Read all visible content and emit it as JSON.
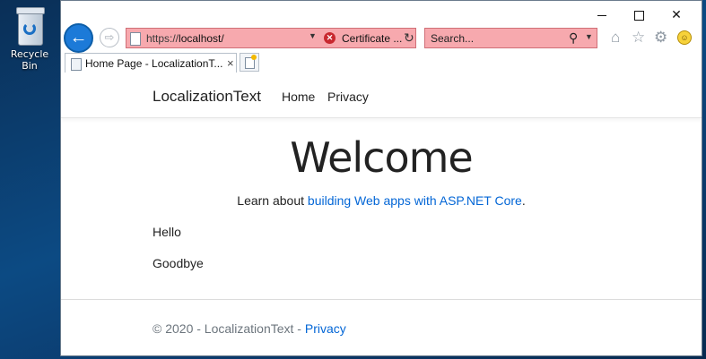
{
  "desktop": {
    "recycle_bin_label": "Recycle Bin"
  },
  "browser": {
    "address": {
      "scheme": "https://",
      "host": "localhost/",
      "certificate_label": "Certificate ..."
    },
    "search": {
      "placeholder": "Search..."
    },
    "tab": {
      "title": "Home Page - LocalizationT...",
      "close_glyph": "×"
    },
    "window_controls": {
      "close_glyph": "✕"
    },
    "icons": {
      "back": "back-arrow-icon",
      "forward": "forward-arrow-icon",
      "home": "home-icon",
      "favorites": "star-icon",
      "tools": "gear-icon",
      "feedback": "smiley-icon"
    },
    "colors": {
      "certificate_error_bg": "#f7a9ae",
      "back_button": "#1c7ad8"
    }
  },
  "site": {
    "brand": "LocalizationText",
    "nav": [
      {
        "label": "Home"
      },
      {
        "label": "Privacy"
      }
    ],
    "heading": "Welcome",
    "learn_prefix": "Learn about ",
    "learn_link": "building Web apps with ASP.NET Core",
    "learn_suffix": ".",
    "lines": [
      "Hello",
      "Goodbye"
    ],
    "footer_text": "© 2020 - LocalizationText - ",
    "footer_link": "Privacy",
    "colors": {
      "link": "#0366d6",
      "muted": "#6c757d"
    }
  }
}
